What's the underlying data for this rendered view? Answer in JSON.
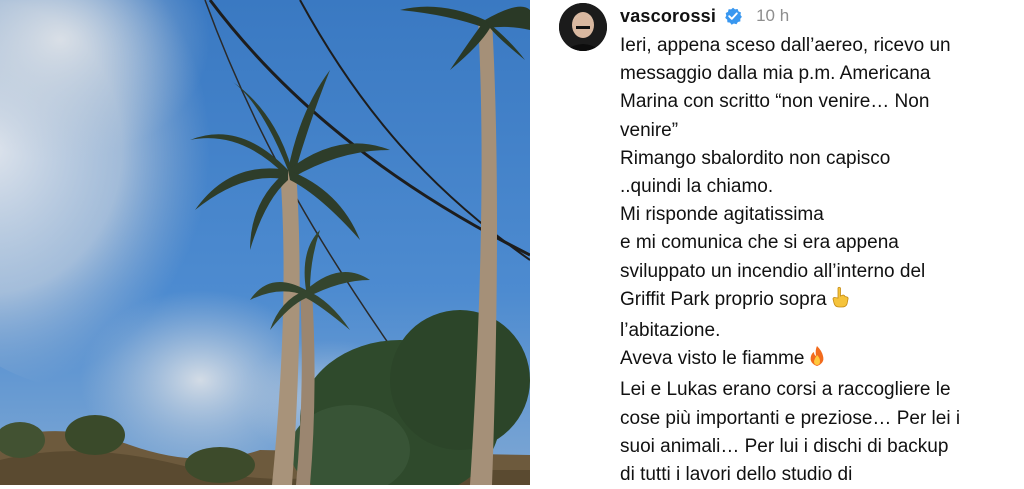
{
  "post": {
    "username": "vascorossi",
    "timestamp": "10 h",
    "caption_lines": [
      "Ieri, appena sceso dall’aereo, ricevo un",
      "messaggio dalla mia p.m. Americana",
      "Marina con scritto “non venire… Non",
      "venire”",
      "Rimango sbalordito non capisco",
      "..quindi la chiamo.",
      "Mi risponde agitatissima",
      "e mi comunica che si era appena",
      "sviluppato un incendio all’interno del",
      "Griffit Park proprio sopra",
      "l’abitazione.",
      "Aveva visto le fiamme",
      "Lei e Lukas erano corsi a raccogliere le",
      "cose più importanti e preziose… Per lei i",
      "suoi animali… Per lui i dischi di backup",
      "di tutti i lavori dello studio di"
    ],
    "icons": {
      "verified": "verified-badge-icon",
      "pointing": "pointing-up-hand-icon",
      "fire": "fire-icon"
    }
  },
  "colors": {
    "verified": "#3897f0",
    "sky": "#3f7fc4",
    "text": "#111111",
    "muted": "#8e8e8e"
  }
}
